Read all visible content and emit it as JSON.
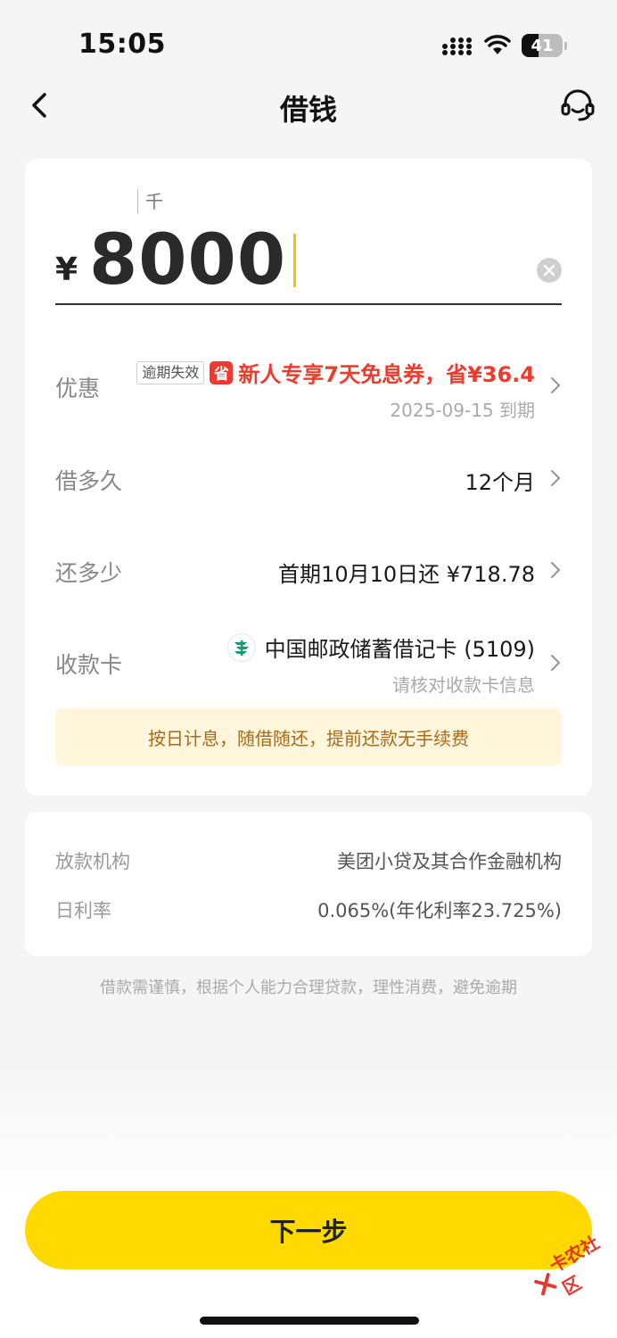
{
  "status_bar": {
    "time": "15:05",
    "battery": "41",
    "battery_level": 0.41,
    "icons": [
      "cellular-signal-icon",
      "wifi-icon",
      "battery-icon"
    ]
  },
  "nav": {
    "title": "借钱",
    "back_icon": "chevron-left-icon",
    "service_icon": "headset-icon"
  },
  "amount": {
    "unit_hint": "千",
    "currency": "¥",
    "value": "8000",
    "clear_icon": "clear-icon"
  },
  "discount": {
    "label": "优惠",
    "expire_tag": "逾期失效",
    "save_tag": "省",
    "coupon_text": "新人专享7天免息券，省¥36.4",
    "expiry": "2025-09-15 到期"
  },
  "term": {
    "label": "借多久",
    "value": "12个月"
  },
  "repay": {
    "label": "还多少",
    "value": "首期10月10日还 ¥718.78"
  },
  "card": {
    "label": "收款卡",
    "bank_name": "中国邮政储蓄借记卡 (5109)",
    "hint": "请核对收款卡信息",
    "bank_icon": "postal-bank-logo"
  },
  "notice": "按日计息，随借随还，提前还款无手续费",
  "info": {
    "lender_label": "放款机构",
    "lender_value": "美团小贷及其合作金融机构",
    "rate_label": "日利率",
    "rate_value": "0.065%(年化利率23.725%)"
  },
  "disclaimer": "借款需谨慎，根据个人能力合理贷款，理性消费，避免逾期",
  "next_button": "下一步",
  "watermark": "卡农社区",
  "colors": {
    "accent": "#ffd900",
    "discount_red": "#f03a2e",
    "notice_bg": "#fff6dc",
    "notice_text": "#a86a1c"
  }
}
